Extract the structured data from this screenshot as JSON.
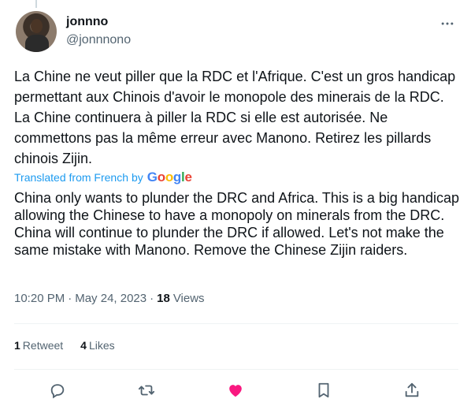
{
  "user": {
    "display_name": "jonnno",
    "handle": "@jonnnono"
  },
  "tweet": {
    "original_text": "La Chine ne veut piller que la RDC et l'Afrique. C'est un gros handicap permettant aux Chinois d'avoir le monopole des minerais de la RDC. La Chine continuera à piller la RDC si elle est autorisée. Ne commettons pas la même erreur avec Manono. Retirez les pillards chinois Zijin.",
    "translated_label": "Translated from French",
    "translated_by": "by",
    "translator": "Google",
    "translation_text": "China only wants to plunder the DRC and Africa. This is a big handicap allowing the Chinese to have a monopoly on minerals from the DRC. China will continue to plunder the DRC if allowed. Let's not make the same mistake with Manono. Remove the Chinese Zijin raiders."
  },
  "meta": {
    "time": "10:20 PM",
    "separator": "·",
    "date": "May 24, 2023",
    "views_count": "18",
    "views_label": "Views"
  },
  "stats": {
    "retweets_count": "1",
    "retweets_label": "Retweet",
    "likes_count": "4",
    "likes_label": "Likes"
  },
  "icons": {
    "more": "more-horizontal-icon",
    "reply": "reply-icon",
    "retweet": "retweet-icon",
    "like": "heart-filled-icon",
    "bookmark": "bookmark-icon",
    "share": "share-icon"
  },
  "colors": {
    "text": "#0f1419",
    "secondary": "#536471",
    "link": "#1d9bf0",
    "like": "#f91880",
    "divider": "#eff3f4"
  }
}
